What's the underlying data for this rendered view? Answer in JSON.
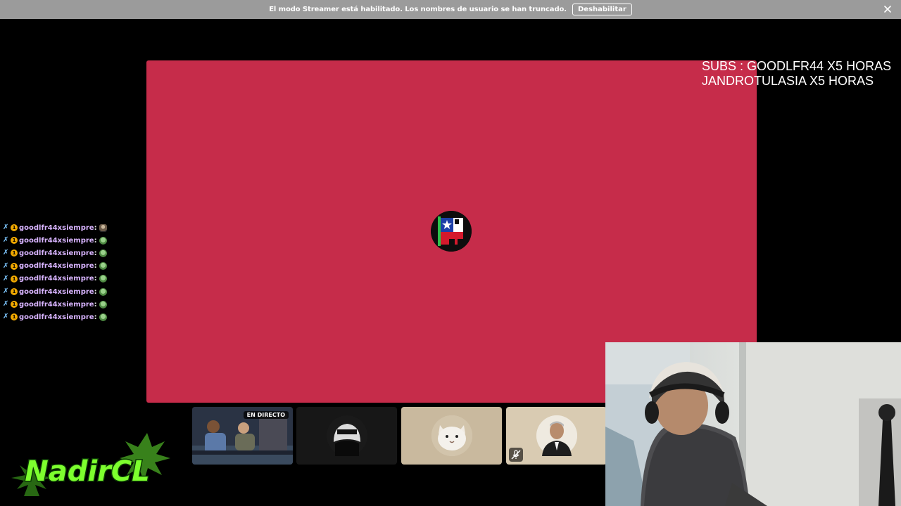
{
  "banner": {
    "message": "El modo Streamer está habilitado. Los nombres de usuario se han truncado.",
    "disable_label": "Deshabilitar",
    "close_icon": "close-icon"
  },
  "subs_overlay": {
    "line1": "SUBS : GOODLFR44 X5 HORAS",
    "line2": "JANDROTULASIA X5 HORAS"
  },
  "chat": {
    "messages": [
      {
        "user": "goodlfr44xsiempre",
        "colon": ":",
        "emote": "portrait-emote"
      },
      {
        "user": "goodlfr44xsiempre",
        "colon": ":",
        "emote": "weed-emote"
      },
      {
        "user": "goodlfr44xsiempre",
        "colon": ":",
        "emote": "weed-emote"
      },
      {
        "user": "goodlfr44xsiempre",
        "colon": ":",
        "emote": "weed-emote"
      },
      {
        "user": "goodlfr44xsiempre",
        "colon": ":",
        "emote": "weed-emote"
      },
      {
        "user": "goodlfr44xsiempre",
        "colon": ":",
        "emote": "weed-emote"
      },
      {
        "user": "goodlfr44xsiempre",
        "colon": ":",
        "emote": "weed-emote"
      },
      {
        "user": "goodlfr44xsiempre",
        "colon": ":",
        "emote": "weed-emote"
      }
    ],
    "sub_badge_text": "1"
  },
  "tiles": [
    {
      "kind": "stream",
      "live_label": "EN DIRECTO"
    },
    {
      "kind": "avatar",
      "avatar": "masked-figure-avatar"
    },
    {
      "kind": "avatar",
      "avatar": "cat-avatar"
    },
    {
      "kind": "avatar",
      "avatar": "man-avatar",
      "muted": true
    }
  ],
  "logo": {
    "text": "NadirCL"
  },
  "colors": {
    "banner_bg": "#9b9b9b",
    "stage_bg": "#c62c4a",
    "chat_user": "#d8b4ff",
    "logo_green": "#7dff2e"
  }
}
